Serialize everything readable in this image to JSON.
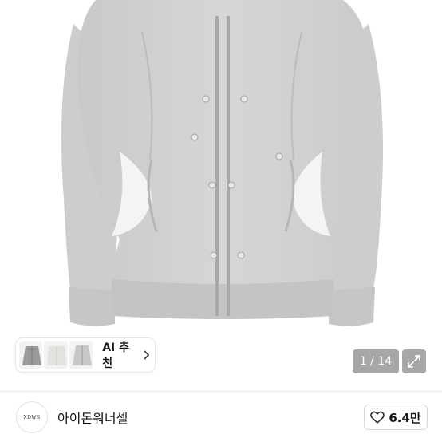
{
  "product_image": {
    "alt": "",
    "counter": "1 / 14"
  },
  "ai_recommend": {
    "label": "AI 추천",
    "thumbnails": [
      "hoodie-thumb",
      "white-top-thumb",
      "grey-hoodie-thumb"
    ]
  },
  "shop": {
    "logo_text": "XDWS",
    "name": "아이돈워너셀",
    "likes": "6.4만"
  },
  "icons": {
    "expand": "expand-arrows-icon",
    "heart": "heart-icon",
    "chevron": "chevron-right-icon"
  },
  "colors": {
    "garment": "#d2d2d2",
    "overlay": "#5a5a5a"
  }
}
